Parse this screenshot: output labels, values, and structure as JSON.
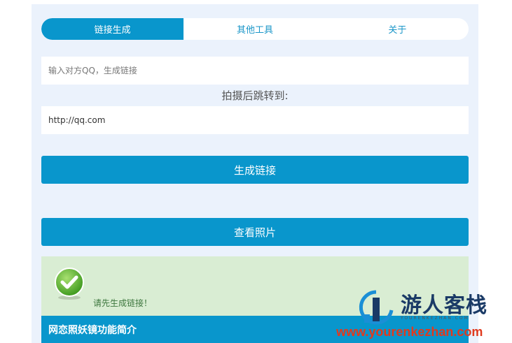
{
  "tabs": [
    {
      "label": "链接生成",
      "active": true
    },
    {
      "label": "其他工具",
      "active": false
    },
    {
      "label": "关于",
      "active": false
    }
  ],
  "form": {
    "qq_placeholder": "输入对方QQ，生成链接",
    "redirect_label": "拍摄后跳转到:",
    "redirect_value": "http://qq.com"
  },
  "buttons": {
    "generate": "生成链接",
    "view": "查看照片"
  },
  "notice": {
    "text": "请先生成链接！",
    "icon": "check-circle-icon"
  },
  "intro": {
    "title": "网恋照妖镜功能简介"
  },
  "watermark": {
    "title": "游人客栈",
    "subtitle": "YOURENKEZHAN.COM",
    "url": "www.yourenkezhan.com"
  },
  "colors": {
    "accent": "#0996cc",
    "panel_bg": "#ebf2fc",
    "notice_bg": "#d9edd3"
  }
}
